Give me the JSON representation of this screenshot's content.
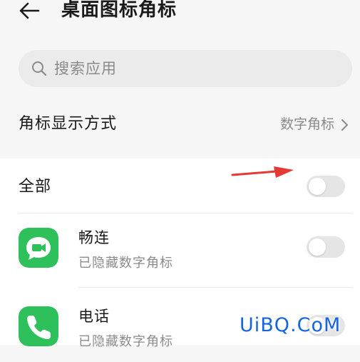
{
  "header": {
    "title": "桌面图标角标",
    "back_icon": "arrow-left-icon"
  },
  "search": {
    "placeholder": "搜索应用",
    "icon": "search-icon"
  },
  "badge_mode": {
    "label": "角标显示方式",
    "value": "数字角标",
    "icon": "chevron-right-icon"
  },
  "all": {
    "label": "全部",
    "enabled": false
  },
  "apps": [
    {
      "name": "畅连",
      "status": "已隐藏数字角标",
      "enabled": false,
      "icon": "changlian-app-icon",
      "icon_color": "#2ec05a"
    },
    {
      "name": "电话",
      "status": "已隐藏数字角标",
      "enabled": false,
      "icon": "phone-app-icon",
      "icon_color": "#2ec05a"
    }
  ],
  "annotation": {
    "color": "#e53935",
    "icon": "red-arrow-icon"
  },
  "watermark": {
    "text": "UiBQ.CoM",
    "color": "#1565e0"
  }
}
